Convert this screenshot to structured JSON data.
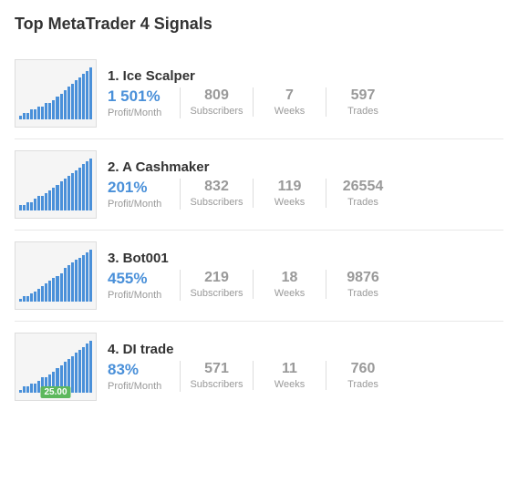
{
  "page": {
    "title": "Top MetaTrader 4 Signals"
  },
  "signals": [
    {
      "rank": "1.",
      "name": "Ice Scalper",
      "profit": "1 501%",
      "profit_label": "Profit/Month",
      "subscribers": "809",
      "subscribers_label": "Subscribers",
      "weeks": "7",
      "weeks_label": "Weeks",
      "trades": "597",
      "trades_label": "Trades",
      "bars": [
        1,
        2,
        2,
        3,
        3,
        4,
        4,
        5,
        5,
        6,
        7,
        8,
        9,
        10,
        11,
        12,
        13,
        14,
        15,
        16
      ],
      "price": null
    },
    {
      "rank": "2.",
      "name": "A Cashmaker",
      "profit": "201%",
      "profit_label": "Profit/Month",
      "subscribers": "832",
      "subscribers_label": "Subscribers",
      "weeks": "119",
      "weeks_label": "Weeks",
      "trades": "26554",
      "trades_label": "Trades",
      "bars": [
        2,
        2,
        3,
        3,
        4,
        5,
        5,
        6,
        7,
        8,
        9,
        10,
        11,
        12,
        13,
        14,
        15,
        16,
        17,
        18
      ],
      "price": null
    },
    {
      "rank": "3.",
      "name": "Bot001",
      "profit": "455%",
      "profit_label": "Profit/Month",
      "subscribers": "219",
      "subscribers_label": "Subscribers",
      "weeks": "18",
      "weeks_label": "Weeks",
      "trades": "9876",
      "trades_label": "Trades",
      "bars": [
        1,
        2,
        2,
        3,
        4,
        5,
        6,
        7,
        8,
        9,
        10,
        11,
        13,
        14,
        15,
        16,
        17,
        18,
        19,
        20
      ],
      "price": null
    },
    {
      "rank": "4.",
      "name": "DI trade",
      "profit": "83%",
      "profit_label": "Profit/Month",
      "subscribers": "571",
      "subscribers_label": "Subscribers",
      "weeks": "11",
      "weeks_label": "Weeks",
      "trades": "760",
      "trades_label": "Trades",
      "bars": [
        1,
        2,
        2,
        3,
        3,
        4,
        5,
        5,
        6,
        7,
        8,
        9,
        10,
        11,
        12,
        13,
        14,
        15,
        16,
        17
      ],
      "price": "25.00"
    }
  ]
}
